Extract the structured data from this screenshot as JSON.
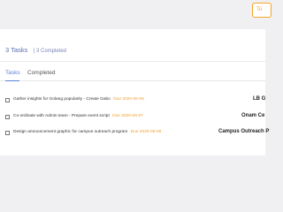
{
  "header": {
    "button_label": "To"
  },
  "summary": {
    "task_count": "3 Tasks",
    "completed_count": "| 3 Completed"
  },
  "tabs": [
    {
      "label": "Tasks",
      "active": true
    },
    {
      "label": "Completed",
      "active": false
    }
  ],
  "tasks": [
    {
      "title": "Gather insights for Golang popularity - Create Gabo",
      "due": "Due 2020-06-05",
      "meta": "LB G",
      "checked": false
    },
    {
      "title": "Co-ordinate with Admin team - Prepare event script",
      "due": "Due 2020-06-07",
      "meta": "Onam Ce",
      "checked": false
    },
    {
      "title": "Design announcement graphic for campus outreach program",
      "due": "Due 2020-06-09",
      "meta": "Campus Outreach P",
      "checked": false
    }
  ],
  "colors": {
    "accent": "#5b7fd6",
    "due": "#f0a030",
    "button_border": "#f5a623",
    "background": "#f0f0f2"
  }
}
